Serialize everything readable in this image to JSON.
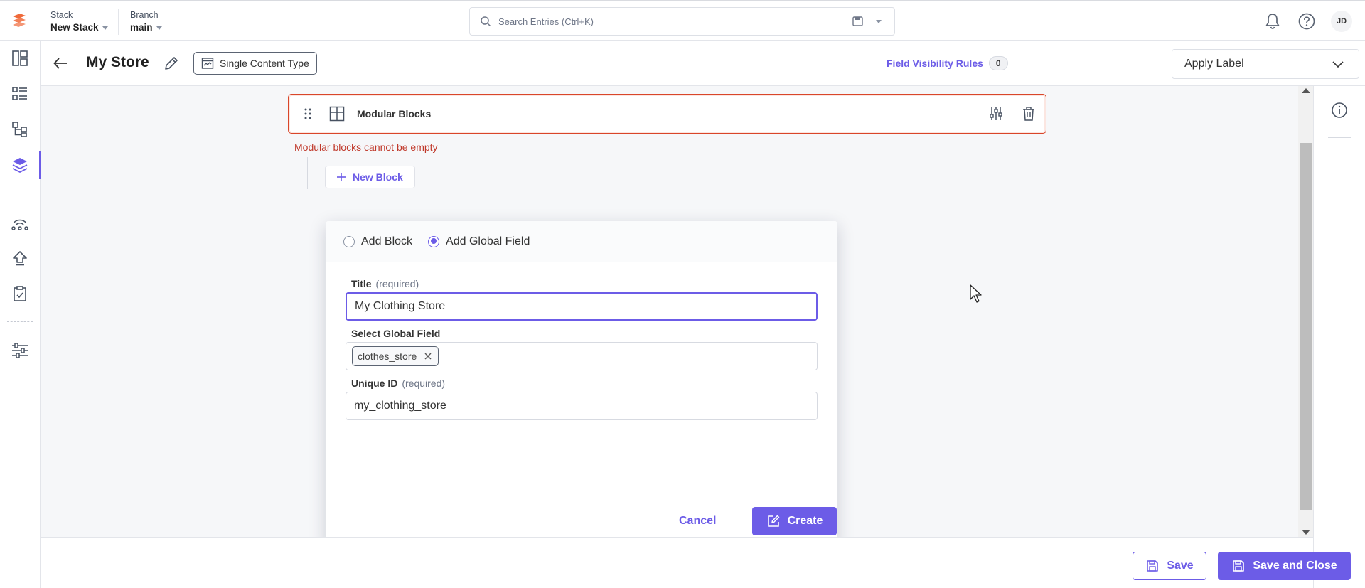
{
  "topbar": {
    "stack_label": "Stack",
    "stack_value": "New Stack",
    "branch_label": "Branch",
    "branch_value": "main",
    "search_placeholder": "Search Entries (Ctrl+K)",
    "avatar_initials": "JD"
  },
  "rail": {
    "items": [
      "dashboard-icon",
      "entries-list-icon",
      "content-models-icon",
      "stack-layers-icon",
      "webhooks-icon",
      "deploy-icon",
      "tasks-icon",
      "settings-icon"
    ],
    "active_index": 3
  },
  "header": {
    "title": "My Store",
    "content_type_badge": "Single Content Type",
    "field_visibility_label": "Field Visibility Rules",
    "field_visibility_count": "0",
    "apply_label": "Apply Label"
  },
  "canvas": {
    "modular_blocks_title": "Modular Blocks",
    "error_text": "Modular blocks cannot be empty",
    "new_block_label": "New Block"
  },
  "modal": {
    "option_add_block": "Add Block",
    "option_add_global_field": "Add Global Field",
    "selected_option": "Add Global Field",
    "title_label": "Title",
    "title_required": "(required)",
    "title_value": "My Clothing Store",
    "select_global_label": "Select Global Field",
    "selected_global_tag": "clothes_store",
    "uid_label": "Unique ID",
    "uid_required": "(required)",
    "uid_value": "my_clothing_store",
    "cancel_label": "Cancel",
    "create_label": "Create"
  },
  "footer": {
    "save_label": "Save",
    "save_close_label": "Save and Close"
  },
  "colors": {
    "accent": "#6c5ce7",
    "error": "#d9462a",
    "logo": "#f06a3a"
  }
}
